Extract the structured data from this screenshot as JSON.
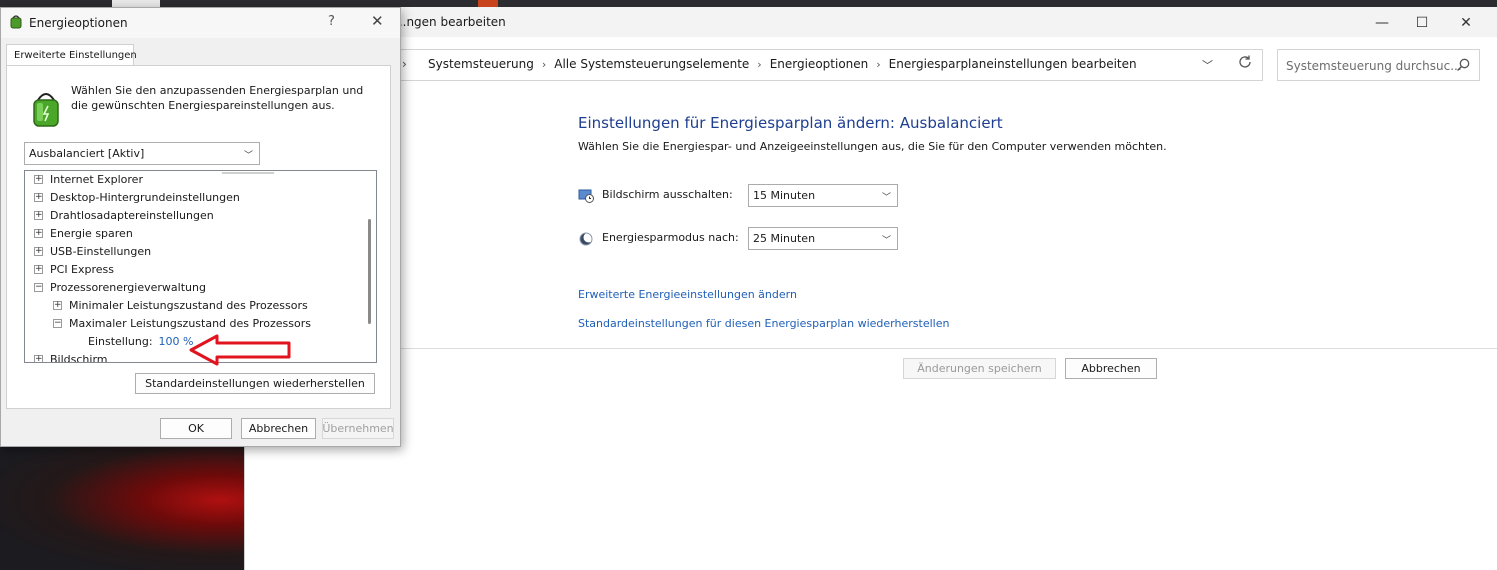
{
  "main_window": {
    "title": "...ngen bearbeiten",
    "controls": {
      "minimize": "—",
      "maximize": "☐",
      "close": "✕"
    },
    "breadcrumbs": [
      "Systemsteuerung",
      "Alle Systemsteuerungselemente",
      "Energieoptionen",
      "Energiesparplaneinstellungen bearbeiten"
    ],
    "search_placeholder": "Systemsteuerung durchsuc...",
    "heading": "Einstellungen für Energiesparplan ändern: Ausbalanciert",
    "subheading": "Wählen Sie die Energiespar- und Anzeigeeinstellungen aus, die Sie für den Computer verwenden möchten.",
    "display_off_label": "Bildschirm ausschalten:",
    "display_off_value": "15 Minuten",
    "sleep_label": "Energiesparmodus nach:",
    "sleep_value": "25 Minuten",
    "link_advanced": "Erweiterte Energieeinstellungen ändern",
    "link_restore": "Standardeinstellungen für diesen Energiesparplan wiederherstellen",
    "save_button": "Änderungen speichern",
    "cancel_button": "Abbrechen"
  },
  "dialog": {
    "title": "Energieoptionen",
    "help": "?",
    "close": "✕",
    "tab": "Erweiterte Einstellungen",
    "description": "Wählen Sie den anzupassenden Energiesparplan und die gewünschten Energiespareinstellungen aus.",
    "plan_select": "Ausbalanciert [Aktiv]",
    "tree": {
      "internet_explorer": "Internet Explorer",
      "desktop_background": "Desktop-Hintergrundeinstellungen",
      "wireless": "Drahtlosadaptereinstellungen",
      "energy_saving": "Energie sparen",
      "usb": "USB-Einstellungen",
      "pci": "PCI Express",
      "processor": "Prozessorenergieverwaltung",
      "min_state": "Minimaler Leistungszustand des Prozessors",
      "max_state": "Maximaler Leistungszustand des Prozessors",
      "setting_label": "Einstellung:",
      "setting_value": "100 %",
      "display": "Bildschirm"
    },
    "restore_button": "Standardeinstellungen wiederherstellen",
    "ok_button": "OK",
    "cancel_button": "Abbrechen",
    "apply_button": "Übernehmen"
  },
  "colors": {
    "heading_blue": "#1e3f8f",
    "link_blue": "#1f5fb8",
    "annotation_red": "#e0141e"
  }
}
